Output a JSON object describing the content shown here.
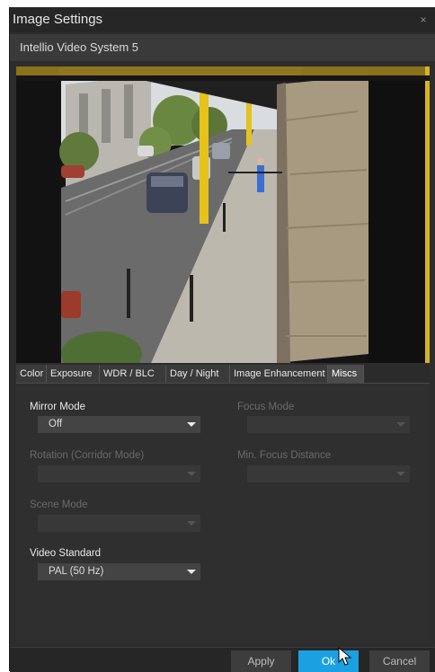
{
  "window": {
    "title": "Image Settings",
    "close_glyph": "×",
    "subtitle": "Intellio Video System 5"
  },
  "video": {
    "description_icon": "camera-live-view"
  },
  "tabs": [
    {
      "label": "Color"
    },
    {
      "label": "Exposure"
    },
    {
      "label": "WDR / BLC"
    },
    {
      "label": "Day / Night"
    },
    {
      "label": "Image Enhancement"
    },
    {
      "label": "Miscs",
      "active": true
    }
  ],
  "settings": {
    "mirror_mode": {
      "label": "Mirror Mode",
      "value": "Off"
    },
    "focus_mode": {
      "label": "Focus Mode",
      "value": ""
    },
    "rotation": {
      "label": "Rotation (Corridor Mode)",
      "value": ""
    },
    "min_focus_distance": {
      "label": "Min. Focus Distance",
      "value": ""
    },
    "scene_mode": {
      "label": "Scene Mode",
      "value": ""
    },
    "video_standard": {
      "label": "Video Standard",
      "value": "PAL (50 Hz)"
    }
  },
  "footer": {
    "apply_label": "Apply",
    "ok_label": "Ok",
    "cancel_label": "Cancel"
  },
  "colors": {
    "accent": "#1ba1e2",
    "background": "#2d2d2d"
  }
}
